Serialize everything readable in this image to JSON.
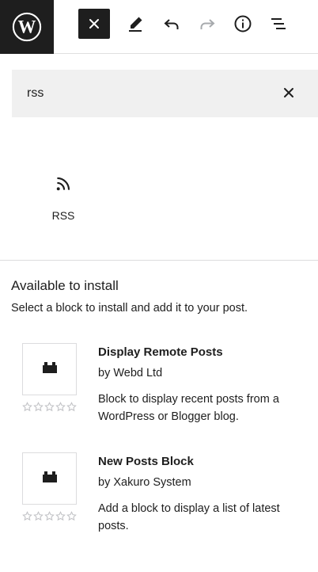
{
  "toolbar": {
    "logo": "wordpress-logo",
    "buttons": [
      {
        "name": "close-inserter",
        "icon": "close-icon"
      },
      {
        "name": "tools",
        "icon": "pencil-icon"
      },
      {
        "name": "undo",
        "icon": "undo-icon"
      },
      {
        "name": "redo",
        "icon": "redo-icon",
        "disabled": true
      },
      {
        "name": "details",
        "icon": "info-icon"
      },
      {
        "name": "list-view",
        "icon": "list-view-icon"
      }
    ]
  },
  "search": {
    "value": "rss",
    "clear_icon": "close-icon"
  },
  "results": [
    {
      "label": "RSS",
      "icon": "rss-icon"
    }
  ],
  "install": {
    "title": "Available to install",
    "description": "Select a block to install and add it to your post.",
    "plugins": [
      {
        "name": "Display Remote Posts",
        "author": "by Webd Ltd",
        "description": "Block to display recent posts from a WordPress or Blogger blog.",
        "rating": 0,
        "icon": "block-default-icon"
      },
      {
        "name": "New Posts Block",
        "author": "by Xakuro System",
        "description": "Add a block to display a list of latest posts.",
        "rating": 0,
        "icon": "block-default-icon"
      }
    ]
  },
  "colors": {
    "dark": "#1e1e1e",
    "search_bg": "#f0f0f0",
    "border": "#dcdcde",
    "disabled": "#a7aaad",
    "star_empty": "#c3c4c7"
  }
}
